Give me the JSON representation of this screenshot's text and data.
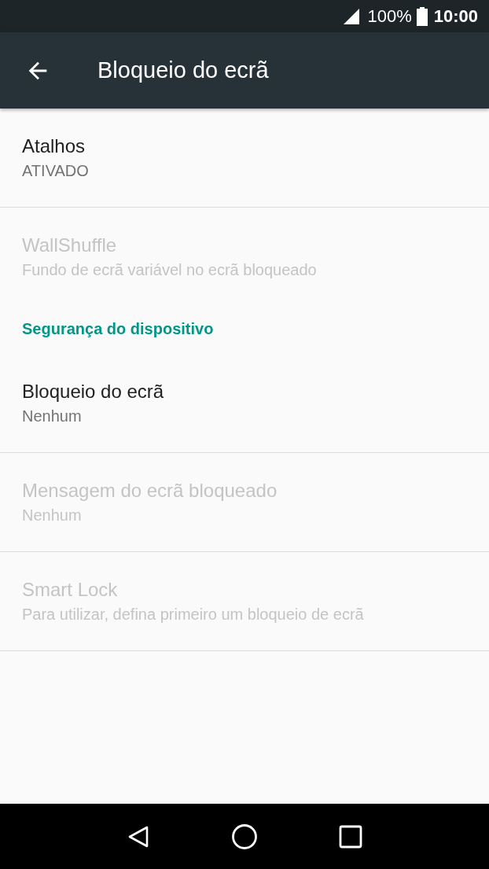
{
  "status_bar": {
    "battery": "100%",
    "time": "10:00"
  },
  "app_bar": {
    "title": "Bloqueio do ecrã"
  },
  "items": [
    {
      "kind": "item",
      "title": "Atalhos",
      "subtitle": "ATIVADO",
      "disabled": false,
      "divider": true
    },
    {
      "kind": "item",
      "title": "WallShuffle",
      "subtitle": "Fundo de ecrã variável no ecrã bloqueado",
      "disabled": true,
      "divider": false
    },
    {
      "kind": "header",
      "title": "Segurança do dispositivo"
    },
    {
      "kind": "item",
      "title": "Bloqueio do ecrã",
      "subtitle": "Nenhum",
      "disabled": false,
      "divider": true
    },
    {
      "kind": "item",
      "title": "Mensagem do ecrã bloqueado",
      "subtitle": "Nenhum",
      "disabled": true,
      "divider": true
    },
    {
      "kind": "item",
      "title": "Smart Lock",
      "subtitle": "Para utilizar, defina primeiro um bloqueio de ecrã",
      "disabled": true,
      "divider": true
    }
  ]
}
